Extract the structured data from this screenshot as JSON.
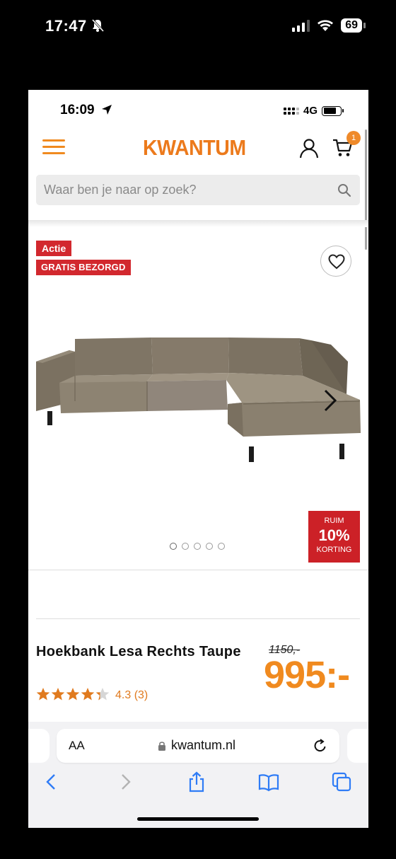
{
  "outer_status": {
    "time": "17:47",
    "battery": "69"
  },
  "inner_status": {
    "time": "16:09",
    "network": "4G"
  },
  "header": {
    "logo": "KWANTUM",
    "cart_count": "1"
  },
  "search": {
    "placeholder": "Waar ben je naar op zoek?"
  },
  "badges": {
    "actie": "Actie",
    "gratis": "GRATIS BEZORGD"
  },
  "discount": {
    "top": "RUIM",
    "percent": "10%",
    "bottom": "KORTING"
  },
  "carousel": {
    "dots": 5,
    "active": 0
  },
  "product": {
    "title": "Hoekbank Lesa Rechts Taupe",
    "rating": 4.3,
    "rating_text": "4.3 (3)",
    "old_price": "1150,-",
    "price": "995:-"
  },
  "browser": {
    "aa": "AA",
    "url": "kwantum.nl"
  },
  "colors": {
    "brand": "#ec7a1c",
    "badge_red": "#d2282e",
    "sofa": "#8a7f6f"
  }
}
